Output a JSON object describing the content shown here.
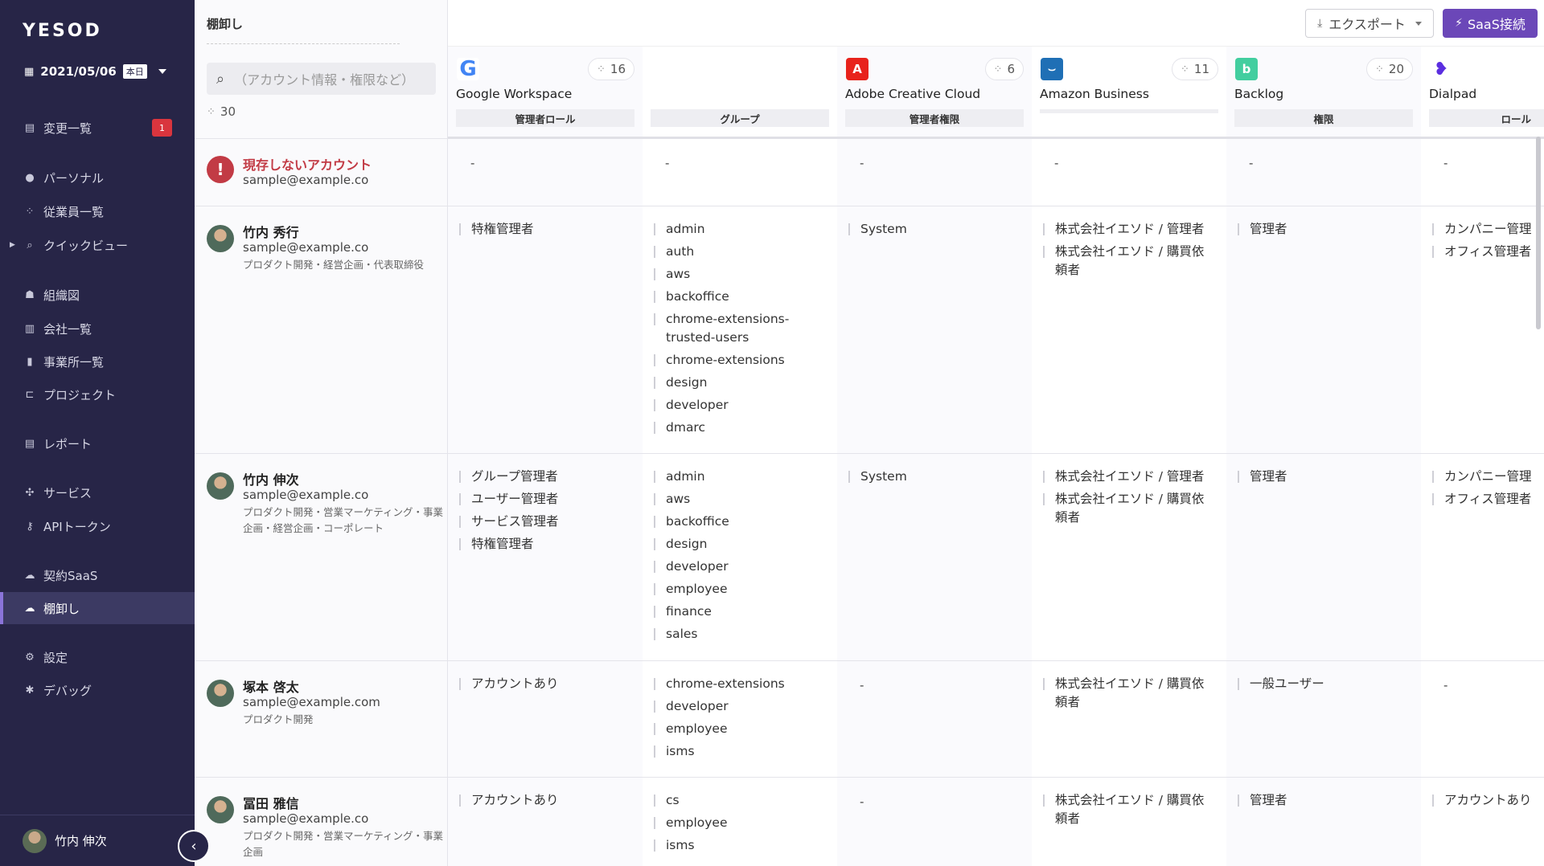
{
  "sidebar": {
    "logo": "YESOD",
    "date": "2021/05/06",
    "date_badge": "本日",
    "items": [
      {
        "label": "変更一覧",
        "icon": "document-icon",
        "badge": "1"
      },
      {
        "label": "パーソナル",
        "icon": "person-icon"
      },
      {
        "label": "従業員一覧",
        "icon": "people-icon"
      },
      {
        "label": "クイックビュー",
        "icon": "search-icon"
      },
      {
        "label": "組織図",
        "icon": "org-chart-icon"
      },
      {
        "label": "会社一覧",
        "icon": "building-icon"
      },
      {
        "label": "事業所一覧",
        "icon": "office-icon"
      },
      {
        "label": "プロジェクト",
        "icon": "project-icon"
      },
      {
        "label": "レポート",
        "icon": "report-icon"
      },
      {
        "label": "サービス",
        "icon": "service-icon"
      },
      {
        "label": "APIトークン",
        "icon": "key-icon"
      },
      {
        "label": "契約SaaS",
        "icon": "cloud-icon"
      },
      {
        "label": "棚卸し",
        "icon": "cloud-upload-icon"
      },
      {
        "label": "設定",
        "icon": "gear-icon"
      },
      {
        "label": "デバッグ",
        "icon": "bug-icon"
      }
    ],
    "user_name": "竹内 伸次"
  },
  "panel": {
    "title": "棚卸し",
    "search_placeholder": "（アカウント情報・権限など）",
    "count": "30"
  },
  "toolbar": {
    "export_label": "エクスポート",
    "saas_label": "SaaS接続"
  },
  "apps": [
    {
      "name": "Google Workspace",
      "count": "16",
      "attributes": [
        "管理者ロール",
        "グループ"
      ],
      "color": "#ffffff"
    },
    {
      "name": "Adobe Creative Cloud",
      "count": "6",
      "attributes": [
        "管理者権限"
      ],
      "color": "#e8231c"
    },
    {
      "name": "Amazon Business",
      "count": "11",
      "attributes": [
        ""
      ],
      "color": "#1f6fb5"
    },
    {
      "name": "Backlog",
      "count": "20",
      "attributes": [
        "権限"
      ],
      "color": "#42ce9f"
    },
    {
      "name": "Dialpad",
      "count": "",
      "attributes": [
        "ロール"
      ],
      "color": "#5b2ee0"
    }
  ],
  "people": [
    {
      "name": "現存しないアカウント",
      "email": "sample@example.co",
      "dept": "",
      "cells": [
        [
          "-"
        ],
        [
          "-"
        ],
        [
          "-"
        ],
        [
          "-"
        ],
        [
          "-"
        ],
        [
          "-"
        ]
      ]
    },
    {
      "name": "竹内 秀行",
      "email": "sample@example.co",
      "dept": "プロダクト開発・経営企画・代表取締役",
      "cells": [
        [
          "特権管理者"
        ],
        [
          "admin",
          "auth",
          "aws",
          "backoffice",
          "chrome-extensions-trusted-users",
          "chrome-extensions",
          "design",
          "developer",
          "dmarc"
        ],
        [
          "System"
        ],
        [
          "株式会社イエソド / 管理者",
          "株式会社イエソド / 購買依頼者"
        ],
        [
          "管理者"
        ],
        [
          "カンパニー管理",
          "オフィス管理者"
        ]
      ]
    },
    {
      "name": "竹内 伸次",
      "email": "sample@example.co",
      "dept": "プロダクト開発・営業マーケティング・事業企画・経営企画・コーポレート",
      "cells": [
        [
          "グループ管理者",
          "ユーザー管理者",
          "サービス管理者",
          "特権管理者"
        ],
        [
          "admin",
          "aws",
          "backoffice",
          "design",
          "developer",
          "employee",
          "finance",
          "sales"
        ],
        [
          "System"
        ],
        [
          "株式会社イエソド / 管理者",
          "株式会社イエソド / 購買依頼者"
        ],
        [
          "管理者"
        ],
        [
          "カンパニー管理",
          "オフィス管理者"
        ]
      ]
    },
    {
      "name": "塚本 啓太",
      "email": "sample@example.com",
      "dept": "プロダクト開発",
      "cells": [
        [
          "アカウントあり"
        ],
        [
          "chrome-extensions",
          "developer",
          "employee",
          "isms"
        ],
        [
          "-"
        ],
        [
          "株式会社イエソド / 購買依頼者"
        ],
        [
          "一般ユーザー"
        ],
        [
          "-"
        ]
      ]
    },
    {
      "name": "冨田 雅信",
      "email": "sample@example.co",
      "dept": "プロダクト開発・営業マーケティング・事業企画",
      "cells": [
        [
          "アカウントあり"
        ],
        [
          "cs",
          "employee",
          "isms"
        ],
        [
          "-"
        ],
        [
          "株式会社イエソド / 購買依頼者"
        ],
        [
          "管理者"
        ],
        [
          "アカウントあり"
        ]
      ]
    }
  ]
}
